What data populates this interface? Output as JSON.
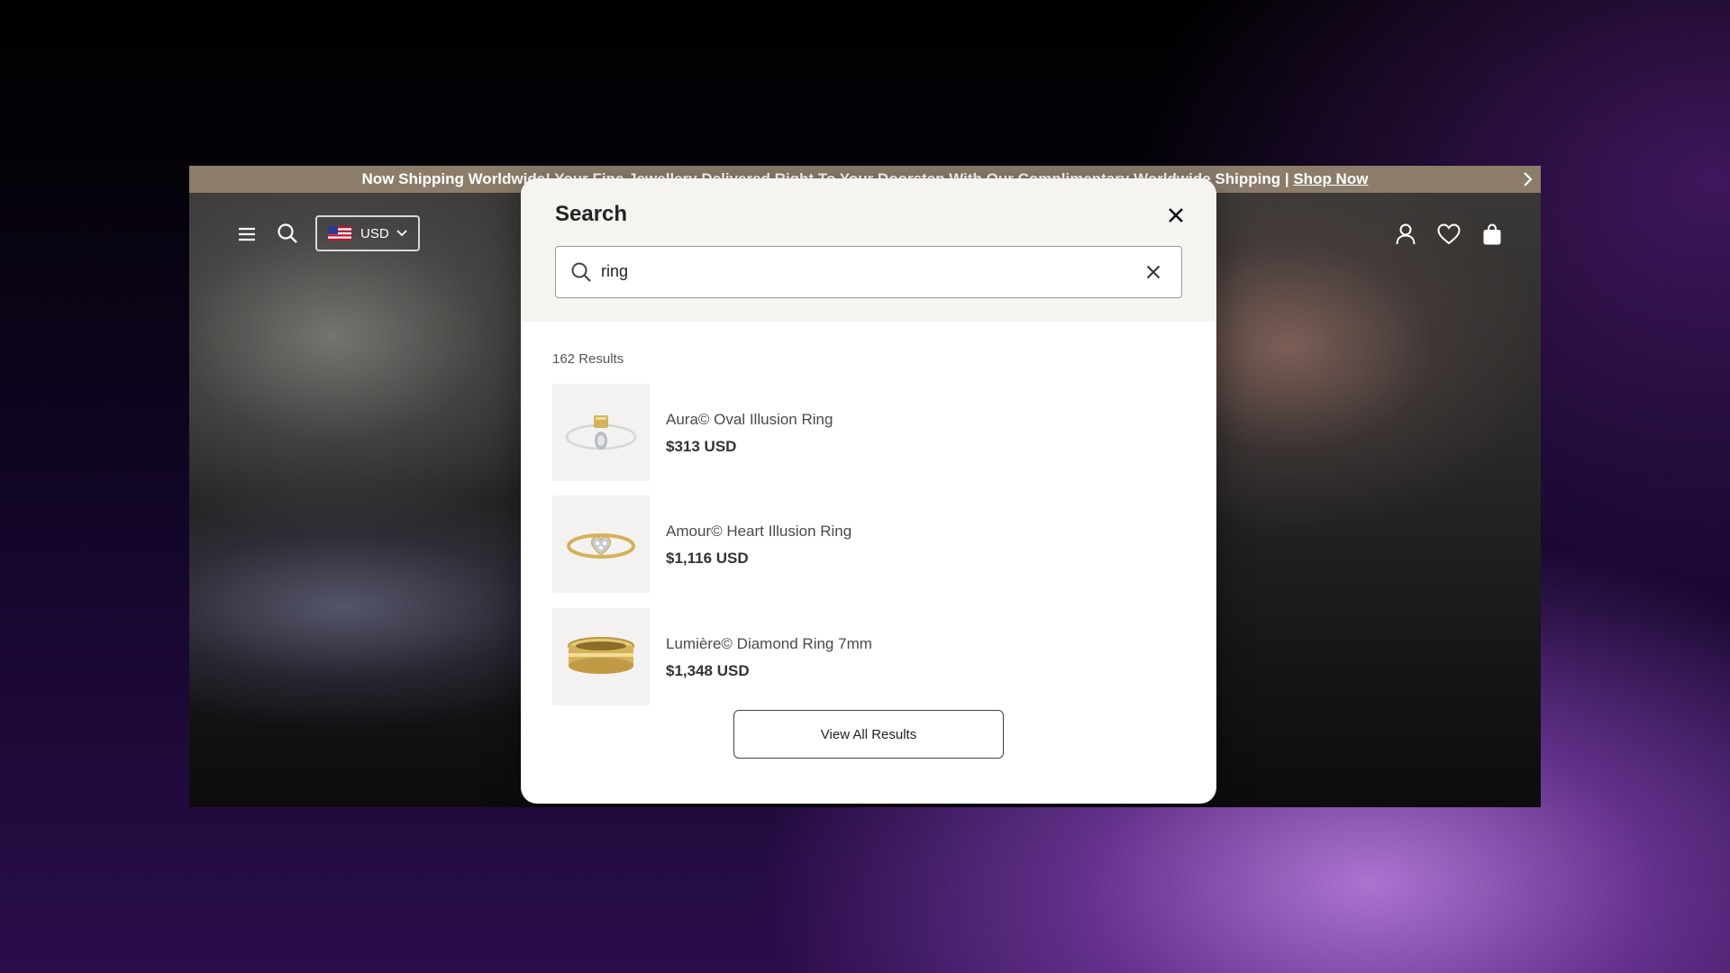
{
  "announcement": {
    "text": "Now Shipping Worldwide! Your Fine Jewellery Delivered Right To Your Doorstep With Our Complimentary Worldwide Shipping | ",
    "link_label": "Shop Now"
  },
  "header": {
    "currency": "USD"
  },
  "search_modal": {
    "title": "Search",
    "query": "ring",
    "result_count": "162 Results",
    "results": [
      {
        "name": "Aura© Oval Illusion Ring",
        "price": "$313 USD"
      },
      {
        "name": "Amour© Heart Illusion Ring",
        "price": "$1,116 USD"
      },
      {
        "name": "Lumière© Diamond Ring 7mm",
        "price": "$1,348 USD"
      }
    ],
    "view_all_label": "View All Results"
  },
  "icons": {
    "menu": "hamburger-icon",
    "search": "search-icon",
    "flag": "us-flag-icon",
    "chevron": "chevron-down-icon",
    "close": "close-icon",
    "clear": "clear-icon",
    "account": "user-icon",
    "wishlist": "heart-icon",
    "cart": "bag-icon",
    "next": "chevron-right-icon"
  },
  "colors": {
    "announcement_bg": "#8b7d6a",
    "modal_header_bg": "#f6f4f1",
    "gold": "#d4b25a"
  }
}
